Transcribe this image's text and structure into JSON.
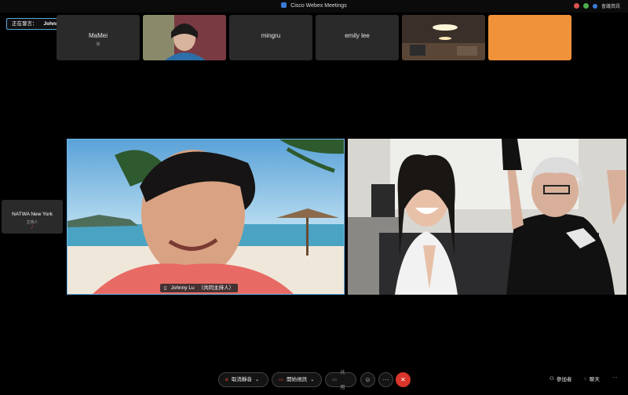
{
  "window": {
    "title": "Cisco Webex Meetings",
    "meeting_info_label": "會議資訊"
  },
  "speaking": {
    "prefix": "正在發言：",
    "name": "Johnny Lu (共同主持人)"
  },
  "thumbnails": [
    {
      "name": "MaMei",
      "sub": "我"
    },
    {
      "name": "",
      "sub": ""
    },
    {
      "name": "mingru",
      "sub": ""
    },
    {
      "name": "emily lee",
      "sub": ""
    },
    {
      "name": "",
      "sub": ""
    },
    {
      "name": "",
      "sub": ""
    }
  ],
  "side_participant": {
    "name": "NATWA New York",
    "role": "主持人"
  },
  "main_video": {
    "name": "Johnny Lu",
    "role": "（共同主持人）"
  },
  "toolbar": {
    "unmute": "取消靜音",
    "start_video": "開始視訊",
    "share": "共用",
    "reactions": "☺",
    "more": "···",
    "end": "✕",
    "participants": "參加者",
    "chat": "聊天",
    "overflow": "···"
  },
  "colors": {
    "accent": "#5aa7d8",
    "end_button": "#d9352b",
    "orange_tile": "#f0923a"
  }
}
